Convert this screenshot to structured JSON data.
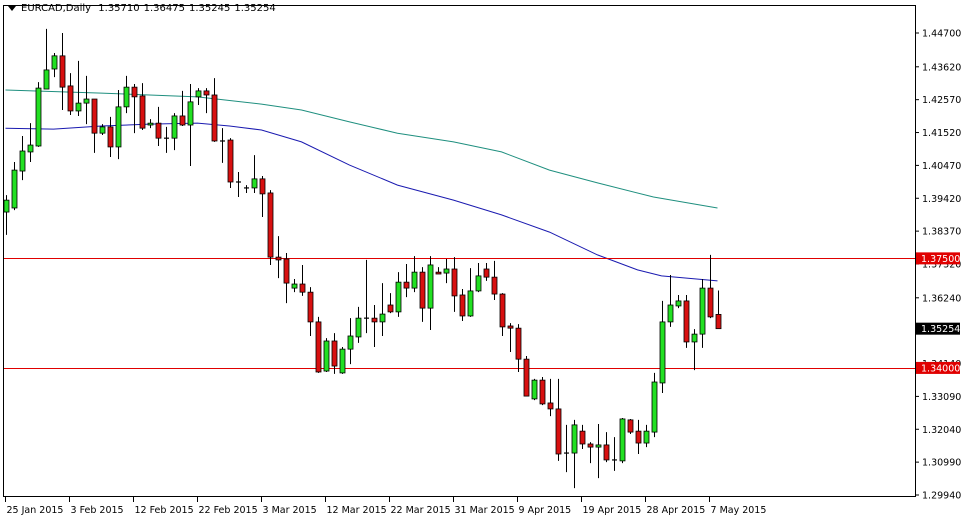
{
  "header": {
    "symbol": "EURCAD,Daily",
    "open": "1.35710",
    "high": "1.36475",
    "low": "1.35245",
    "close": "1.35254"
  },
  "colors": {
    "bull": "#22e022",
    "bear": "#d81010",
    "outline": "#000000",
    "ma_slow": "#1f8f7f",
    "ma_fast": "#1a1ab0",
    "level": "#e00000",
    "current_price_bg": "#000000"
  },
  "chart_data": {
    "type": "candlestick",
    "title": "EURCAD,Daily",
    "ylim": [
      1.2994,
      1.447
    ],
    "y_ticks": [
      "1.44700",
      "1.43620",
      "1.42570",
      "1.41520",
      "1.40470",
      "1.39420",
      "1.38370",
      "1.37320",
      "1.36240",
      "1.34140",
      "1.33090",
      "1.32040",
      "1.30990",
      "1.29940"
    ],
    "current_price": "1.35254",
    "levels": [
      {
        "price": 1.375,
        "label": "1.37500"
      },
      {
        "price": 1.34,
        "label": "1.34000"
      }
    ],
    "x_labels": [
      {
        "index": 0,
        "label": "25 Jan 2015"
      },
      {
        "index": 8,
        "label": "3 Feb 2015"
      },
      {
        "index": 16,
        "label": "12 Feb 2015"
      },
      {
        "index": 24,
        "label": "22 Feb 2015"
      },
      {
        "index": 32,
        "label": "3 Mar 2015"
      },
      {
        "index": 40,
        "label": "12 Mar 2015"
      },
      {
        "index": 48,
        "label": "22 Mar 2015"
      },
      {
        "index": 56,
        "label": "31 Mar 2015"
      },
      {
        "index": 64,
        "label": "9 Apr 2015"
      },
      {
        "index": 72,
        "label": "19 Apr 2015"
      },
      {
        "index": 80,
        "label": "28 Apr 2015"
      },
      {
        "index": 88,
        "label": "7 May 2015"
      }
    ],
    "ohlc": [
      [
        1.3898,
        1.3952,
        1.3825,
        1.3936
      ],
      [
        1.3911,
        1.4058,
        1.3904,
        1.4032
      ],
      [
        1.4029,
        1.4141,
        1.4,
        1.4093
      ],
      [
        1.409,
        1.4182,
        1.4058,
        1.4112
      ],
      [
        1.4109,
        1.4313,
        1.4106,
        1.4294
      ],
      [
        1.4291,
        1.4483,
        1.4291,
        1.4352
      ],
      [
        1.4355,
        1.4406,
        1.4329,
        1.4397
      ],
      [
        1.4397,
        1.447,
        1.4224,
        1.4297
      ],
      [
        1.4301,
        1.4342,
        1.4208,
        1.4221
      ],
      [
        1.4221,
        1.4381,
        1.4205,
        1.4246
      ],
      [
        1.4246,
        1.4333,
        1.4179,
        1.4259
      ],
      [
        1.4259,
        1.4259,
        1.4087,
        1.415
      ],
      [
        1.415,
        1.4179,
        1.4144,
        1.417
      ],
      [
        1.417,
        1.4202,
        1.4074,
        1.4106
      ],
      [
        1.4106,
        1.4288,
        1.4067,
        1.4234
      ],
      [
        1.4234,
        1.4333,
        1.4214,
        1.4297
      ],
      [
        1.4297,
        1.4307,
        1.415,
        1.4266
      ],
      [
        1.4269,
        1.431,
        1.416,
        1.4166
      ],
      [
        1.4176,
        1.4195,
        1.4166,
        1.4182
      ],
      [
        1.4182,
        1.4234,
        1.4109,
        1.4134
      ],
      [
        1.4134,
        1.417,
        1.4087,
        1.4134
      ],
      [
        1.4134,
        1.4214,
        1.4096,
        1.4205
      ],
      [
        1.4205,
        1.4285,
        1.4173,
        1.4176
      ],
      [
        1.4176,
        1.4307,
        1.4045,
        1.425
      ],
      [
        1.4266,
        1.4294,
        1.424,
        1.4285
      ],
      [
        1.4285,
        1.4294,
        1.4214,
        1.4272
      ],
      [
        1.4272,
        1.4326,
        1.4122,
        1.4125
      ],
      [
        1.4125,
        1.4166,
        1.4055,
        1.4125
      ],
      [
        1.4128,
        1.4134,
        1.3975,
        1.3994
      ],
      [
        1.3994,
        1.4026,
        1.3946,
        1.3991
      ],
      [
        1.3975,
        1.3984,
        1.3959,
        1.3975
      ],
      [
        1.3975,
        1.408,
        1.3959,
        1.4004
      ],
      [
        1.4004,
        1.4013,
        1.3882,
        1.3956
      ],
      [
        1.3959,
        1.3968,
        1.3729,
        1.3754
      ],
      [
        1.3754,
        1.3821,
        1.3687,
        1.3745
      ],
      [
        1.3748,
        1.3767,
        1.3607,
        1.3671
      ],
      [
        1.3655,
        1.3684,
        1.3642,
        1.3668
      ],
      [
        1.3668,
        1.3729,
        1.363,
        1.3642
      ],
      [
        1.3642,
        1.3658,
        1.3502,
        1.3547
      ],
      [
        1.3547,
        1.3563,
        1.3384,
        1.3387
      ],
      [
        1.339,
        1.3495,
        1.3387,
        1.3486
      ],
      [
        1.3486,
        1.3511,
        1.3381,
        1.3406
      ],
      [
        1.3384,
        1.3467,
        1.3381,
        1.346
      ],
      [
        1.346,
        1.3559,
        1.3412,
        1.3502
      ],
      [
        1.3499,
        1.3595,
        1.348,
        1.3559
      ],
      [
        1.3559,
        1.3745,
        1.3511,
        1.3559
      ],
      [
        1.3559,
        1.3601,
        1.3467,
        1.3547
      ],
      [
        1.3547,
        1.3671,
        1.3502,
        1.3572
      ],
      [
        1.3601,
        1.3639,
        1.3575,
        1.3579
      ],
      [
        1.3579,
        1.3706,
        1.3563,
        1.3674
      ],
      [
        1.3674,
        1.3732,
        1.3626,
        1.3655
      ],
      [
        1.3655,
        1.3757,
        1.3642,
        1.3706
      ],
      [
        1.3706,
        1.3722,
        1.3547,
        1.3591
      ],
      [
        1.3591,
        1.3757,
        1.3521,
        1.3729
      ],
      [
        1.3706,
        1.3722,
        1.37,
        1.37
      ],
      [
        1.3703,
        1.3748,
        1.3671,
        1.3716
      ],
      [
        1.3716,
        1.3754,
        1.3579,
        1.363
      ],
      [
        1.3633,
        1.3652,
        1.355,
        1.3566
      ],
      [
        1.3566,
        1.3719,
        1.3563,
        1.3646
      ],
      [
        1.3646,
        1.3735,
        1.3642,
        1.3694
      ],
      [
        1.3716,
        1.3735,
        1.3678,
        1.369
      ],
      [
        1.369,
        1.3742,
        1.3617,
        1.3636
      ],
      [
        1.3636,
        1.3639,
        1.3502,
        1.3531
      ],
      [
        1.3534,
        1.3543,
        1.3451,
        1.3527
      ],
      [
        1.3527,
        1.354,
        1.3387,
        1.3428
      ],
      [
        1.3428,
        1.3438,
        1.331,
        1.331
      ],
      [
        1.3301,
        1.3365,
        1.3297,
        1.3361
      ],
      [
        1.3361,
        1.3371,
        1.3281,
        1.3285
      ],
      [
        1.3288,
        1.3365,
        1.3246,
        1.3269
      ],
      [
        1.3269,
        1.3365,
        1.3103,
        1.3125
      ],
      [
        1.3128,
        1.3218,
        1.3067,
        1.3128
      ],
      [
        1.3128,
        1.3234,
        1.3016,
        1.3218
      ],
      [
        1.3198,
        1.3218,
        1.3141,
        1.3157
      ],
      [
        1.3157,
        1.3163,
        1.3096,
        1.3147
      ],
      [
        1.3147,
        1.3221,
        1.3048,
        1.3154
      ],
      [
        1.3154,
        1.3195,
        1.3099,
        1.3106
      ],
      [
        1.3106,
        1.3179,
        1.3071,
        1.3106
      ],
      [
        1.3103,
        1.324,
        1.3096,
        1.3237
      ],
      [
        1.3234,
        1.3237,
        1.3189,
        1.3195
      ],
      [
        1.3198,
        1.3234,
        1.3125,
        1.316
      ],
      [
        1.316,
        1.3218,
        1.3147,
        1.3198
      ],
      [
        1.3195,
        1.3384,
        1.3179,
        1.3355
      ],
      [
        1.3352,
        1.3614,
        1.332,
        1.3547
      ],
      [
        1.3547,
        1.3697,
        1.3531,
        1.3601
      ],
      [
        1.3598,
        1.3633,
        1.3591,
        1.3614
      ],
      [
        1.3614,
        1.3633,
        1.3464,
        1.3483
      ],
      [
        1.3483,
        1.3524,
        1.3393,
        1.3508
      ],
      [
        1.3508,
        1.3684,
        1.3464,
        1.3655
      ],
      [
        1.3655,
        1.3761,
        1.3559,
        1.3563
      ],
      [
        1.3571,
        1.36475,
        1.35245,
        1.35254
      ]
    ],
    "moving_averages": [
      {
        "name": "slow-ma",
        "points": [
          [
            0,
            1.4288
          ],
          [
            12,
            1.4278
          ],
          [
            24,
            1.4266
          ],
          [
            32,
            1.4243
          ],
          [
            37,
            1.4224
          ],
          [
            43,
            1.4186
          ],
          [
            49,
            1.415
          ],
          [
            56,
            1.4122
          ],
          [
            62,
            1.409
          ],
          [
            68,
            1.4032
          ],
          [
            74,
            1.3991
          ],
          [
            81,
            1.3946
          ],
          [
            89,
            1.3911
          ]
        ]
      },
      {
        "name": "fast-ma",
        "points": [
          [
            0,
            1.4166
          ],
          [
            6,
            1.4163
          ],
          [
            12,
            1.4173
          ],
          [
            18,
            1.4179
          ],
          [
            24,
            1.4182
          ],
          [
            28,
            1.4173
          ],
          [
            32,
            1.416
          ],
          [
            37,
            1.4122
          ],
          [
            43,
            1.4048
          ],
          [
            49,
            1.3984
          ],
          [
            56,
            1.3936
          ],
          [
            62,
            1.3889
          ],
          [
            68,
            1.3834
          ],
          [
            74,
            1.3761
          ],
          [
            79,
            1.3713
          ],
          [
            82,
            1.3694
          ],
          [
            89,
            1.3678
          ]
        ]
      }
    ]
  }
}
